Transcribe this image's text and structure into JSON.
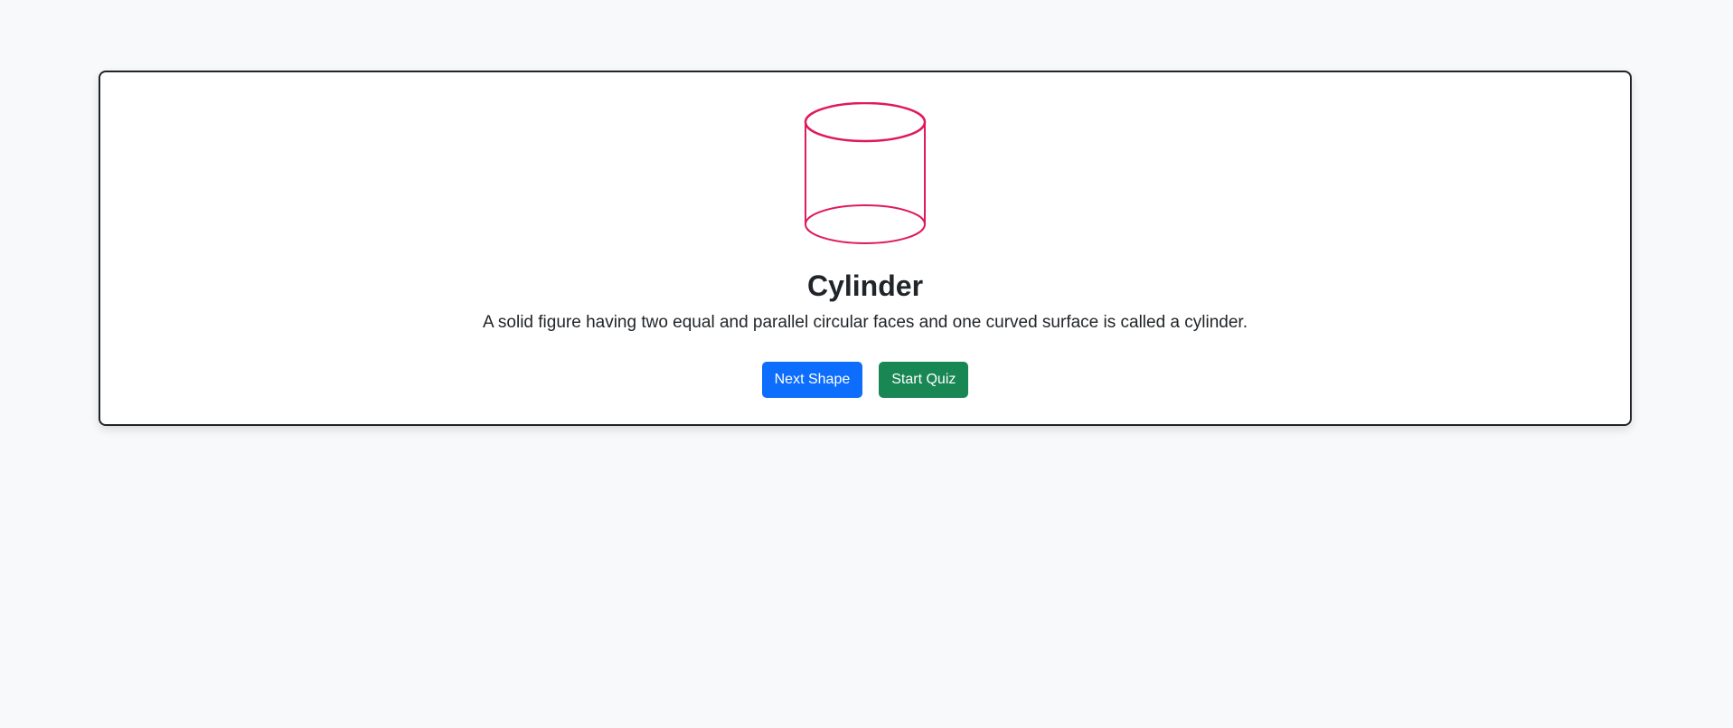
{
  "shape": {
    "icon": "cylinder-icon",
    "stroke_color": "#e0195f",
    "title": "Cylinder",
    "description": "A solid figure having two equal and parallel circular faces and one curved surface is called a cylinder."
  },
  "actions": {
    "next_label": "Next Shape",
    "quiz_label": "Start Quiz",
    "next_color": "#0d6efd",
    "quiz_color": "#198754"
  }
}
